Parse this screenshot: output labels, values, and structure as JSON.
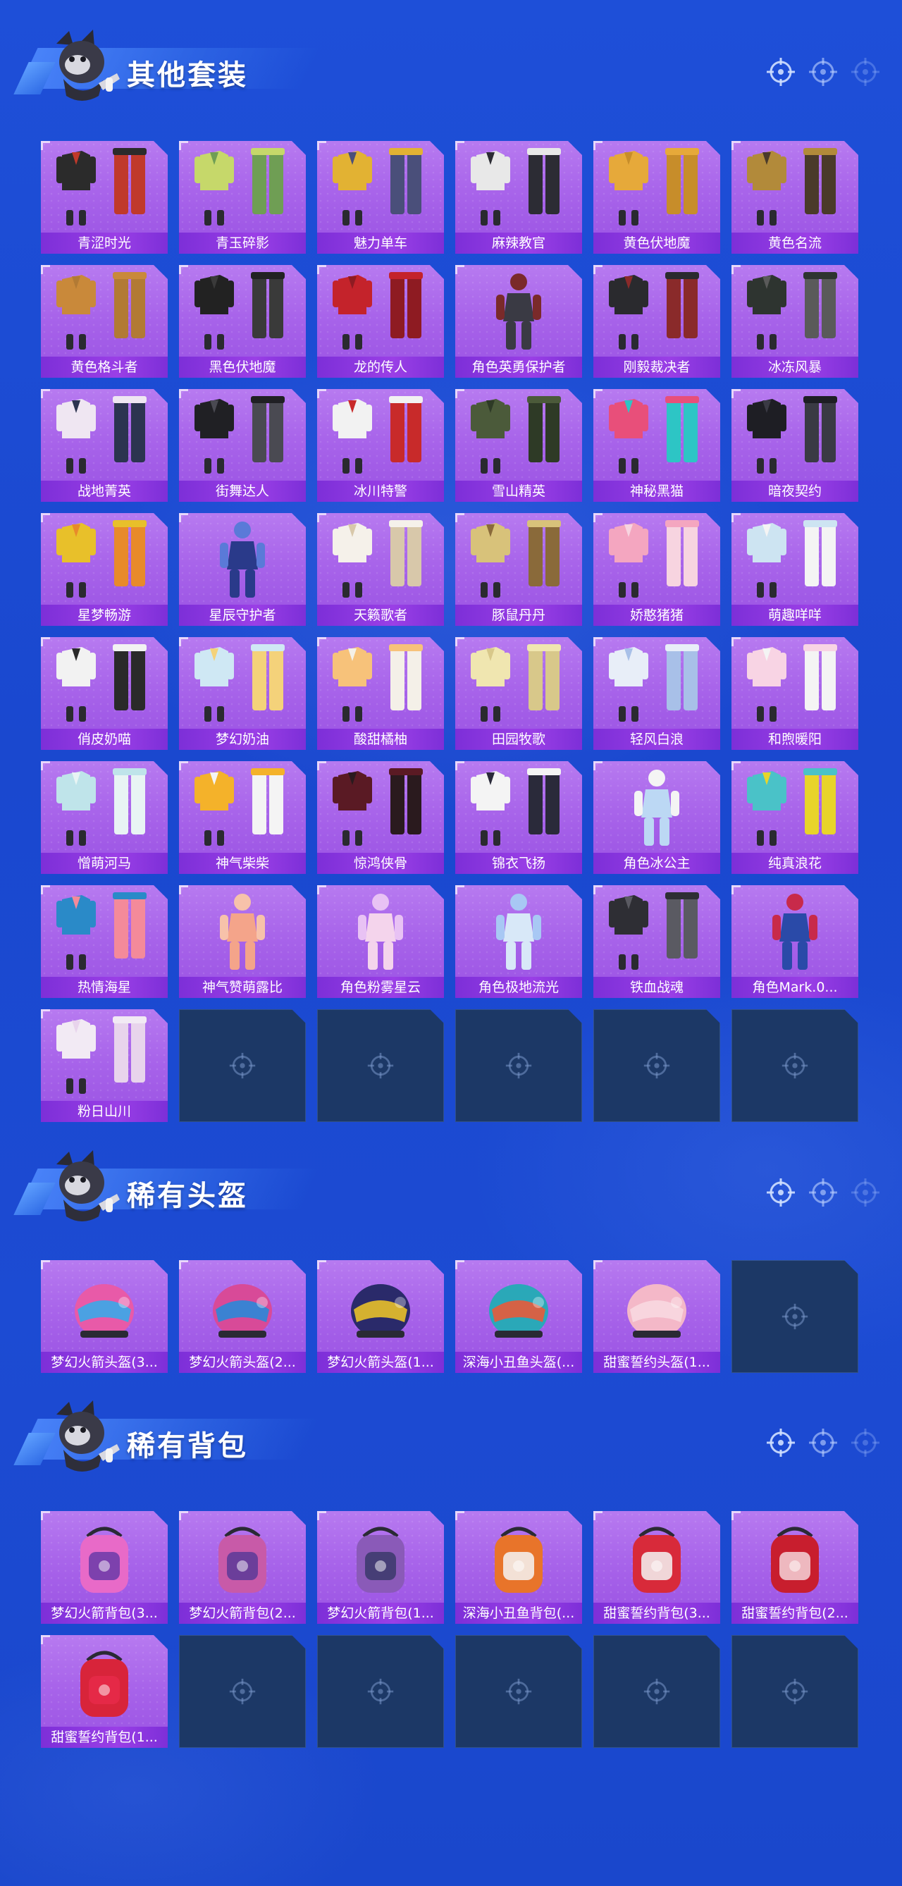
{
  "sections": [
    {
      "title": "其他套装",
      "items": [
        {
          "label": "青涩时光",
          "type": "outfit",
          "palette": [
            "#2b2b2b",
            "#c0392b"
          ]
        },
        {
          "label": "青玉碎影",
          "type": "outfit",
          "palette": [
            "#c6d86a",
            "#6f9e54"
          ]
        },
        {
          "label": "魅力单车",
          "type": "outfit",
          "palette": [
            "#e2b233",
            "#4a4f7a"
          ]
        },
        {
          "label": "麻辣教官",
          "type": "outfit",
          "palette": [
            "#e8e8e8",
            "#2c2c34"
          ]
        },
        {
          "label": "黄色伏地魔",
          "type": "outfit",
          "palette": [
            "#e6a93a",
            "#c78d2a"
          ]
        },
        {
          "label": "黄色名流",
          "type": "outfit",
          "palette": [
            "#b28a3a",
            "#4a3a2a"
          ]
        },
        {
          "label": "黄色格斗者",
          "type": "outfit",
          "palette": [
            "#c9893a",
            "#b27a34"
          ]
        },
        {
          "label": "黑色伏地魔",
          "type": "outfit",
          "palette": [
            "#222222",
            "#3a3a3a"
          ]
        },
        {
          "label": "龙的传人",
          "type": "outfit",
          "palette": [
            "#c4232b",
            "#8e1b22"
          ]
        },
        {
          "label": "角色英勇保护者",
          "type": "character",
          "palette": [
            "#3a3a44",
            "#7a2a2a"
          ]
        },
        {
          "label": "刚毅裁决者",
          "type": "outfit",
          "palette": [
            "#2a2a2e",
            "#8a2a2a"
          ]
        },
        {
          "label": "冰冻风暴",
          "type": "outfit",
          "palette": [
            "#2e3430",
            "#5a5a5a"
          ]
        },
        {
          "label": "战地菁英",
          "type": "outfit",
          "palette": [
            "#efe6f2",
            "#2c3450"
          ]
        },
        {
          "label": "街舞达人",
          "type": "outfit",
          "palette": [
            "#202024",
            "#4a4a52"
          ]
        },
        {
          "label": "冰川特警",
          "type": "outfit",
          "palette": [
            "#f2f2f2",
            "#c82a2a"
          ]
        },
        {
          "label": "雪山精英",
          "type": "outfit",
          "palette": [
            "#4b5a3a",
            "#2e3a26"
          ]
        },
        {
          "label": "神秘黑猫",
          "type": "outfit",
          "palette": [
            "#e84f7a",
            "#2dc5c5"
          ]
        },
        {
          "label": "暗夜契约",
          "type": "outfit",
          "palette": [
            "#1e1e24",
            "#3a3a44"
          ]
        },
        {
          "label": "星梦畅游",
          "type": "outfit",
          "palette": [
            "#e8c02a",
            "#e88a2a"
          ]
        },
        {
          "label": "星辰守护者",
          "type": "character",
          "palette": [
            "#2a3a8a",
            "#5a7ad8"
          ]
        },
        {
          "label": "天籁歌者",
          "type": "outfit",
          "palette": [
            "#f5f1ea",
            "#d8c8aa"
          ]
        },
        {
          "label": "豚鼠丹丹",
          "type": "outfit",
          "palette": [
            "#d8c27a",
            "#8a6a3a"
          ]
        },
        {
          "label": "娇憨猪猪",
          "type": "outfit",
          "palette": [
            "#f4a6c0",
            "#f7d4e0"
          ]
        },
        {
          "label": "萌趣咩咩",
          "type": "outfit",
          "palette": [
            "#cde4f2",
            "#f4f4f4"
          ]
        },
        {
          "label": "俏皮奶喵",
          "type": "outfit",
          "palette": [
            "#f2f2f2",
            "#2a2a2a"
          ]
        },
        {
          "label": "梦幻奶油",
          "type": "outfit",
          "palette": [
            "#cfe8f4",
            "#f4d27a"
          ]
        },
        {
          "label": "酸甜橘柚",
          "type": "outfit",
          "palette": [
            "#f7c27a",
            "#f4f0e8"
          ]
        },
        {
          "label": "田园牧歌",
          "type": "outfit",
          "palette": [
            "#f0e6b0",
            "#d8c88a"
          ]
        },
        {
          "label": "轻风白浪",
          "type": "outfit",
          "palette": [
            "#e8eef8",
            "#a8c0e8"
          ]
        },
        {
          "label": "和煦暖阳",
          "type": "outfit",
          "palette": [
            "#f8d4e4",
            "#f4f4f4"
          ]
        },
        {
          "label": "憎萌河马",
          "type": "outfit",
          "palette": [
            "#bfe4ea",
            "#e8f4f4"
          ]
        },
        {
          "label": "神气柴柴",
          "type": "outfit",
          "palette": [
            "#f4b22a",
            "#f4f4f4"
          ]
        },
        {
          "label": "惊鸿侠骨",
          "type": "outfit",
          "palette": [
            "#5a1a24",
            "#2a1a1e"
          ]
        },
        {
          "label": "锦衣飞扬",
          "type": "outfit",
          "palette": [
            "#f4f4f4",
            "#2a2a3a"
          ]
        },
        {
          "label": "角色冰公主",
          "type": "character",
          "palette": [
            "#bcd8f4",
            "#f4f4f4"
          ]
        },
        {
          "label": "纯真浪花",
          "type": "outfit",
          "palette": [
            "#4ac2c8",
            "#e8d42a"
          ]
        },
        {
          "label": "热情海星",
          "type": "outfit",
          "palette": [
            "#2a8ac8",
            "#f48a9a"
          ]
        },
        {
          "label": "神气赞萌露比",
          "type": "character",
          "palette": [
            "#f4a48a",
            "#f7c2aa"
          ]
        },
        {
          "label": "角色粉雾星云",
          "type": "character",
          "palette": [
            "#f4d4ec",
            "#e8c2f4"
          ]
        },
        {
          "label": "角色极地流光",
          "type": "character",
          "palette": [
            "#d8e8f8",
            "#a8c8f4"
          ]
        },
        {
          "label": "铁血战魂",
          "type": "outfit",
          "palette": [
            "#2e2e34",
            "#5a5a62"
          ]
        },
        {
          "label": "角色Mark.0...",
          "type": "character",
          "palette": [
            "#2a4aa8",
            "#c82a4a"
          ]
        },
        {
          "label": "粉日山川",
          "type": "outfit",
          "palette": [
            "#f2eaf4",
            "#e8d4ec"
          ]
        }
      ],
      "empty_slots": 5
    },
    {
      "title": "稀有头盔",
      "items": [
        {
          "label": "梦幻火箭头盔(3...",
          "type": "helmet",
          "palette": [
            "#e85aa8",
            "#3aa8e8"
          ]
        },
        {
          "label": "梦幻火箭头盔(2...",
          "type": "helmet",
          "palette": [
            "#d84a98",
            "#2a88d8"
          ]
        },
        {
          "label": "梦幻火箭头盔(1...",
          "type": "helmet",
          "palette": [
            "#2a2a6a",
            "#e8c02a"
          ]
        },
        {
          "label": "深海小丑鱼头盔(...",
          "type": "helmet",
          "palette": [
            "#2aa8b8",
            "#e85a3a"
          ]
        },
        {
          "label": "甜蜜誓约头盔(1...",
          "type": "helmet",
          "palette": [
            "#f4b8c8",
            "#f8d8e0"
          ]
        }
      ],
      "empty_slots": 1
    },
    {
      "title": "稀有背包",
      "items": [
        {
          "label": "梦幻火箭背包(3...",
          "type": "backpack",
          "palette": [
            "#e86ac8",
            "#6a3aa8"
          ]
        },
        {
          "label": "梦幻火箭背包(2...",
          "type": "backpack",
          "palette": [
            "#c85aa8",
            "#5a3a98"
          ]
        },
        {
          "label": "梦幻火箭背包(1...",
          "type": "backpack",
          "palette": [
            "#8a5ab8",
            "#3a3a6a"
          ]
        },
        {
          "label": "深海小丑鱼背包(...",
          "type": "backpack",
          "palette": [
            "#e8742a",
            "#f4f4f4"
          ]
        },
        {
          "label": "甜蜜誓约背包(3...",
          "type": "backpack",
          "palette": [
            "#d82a3a",
            "#f4f4f4"
          ]
        },
        {
          "label": "甜蜜誓约背包(2...",
          "type": "backpack",
          "palette": [
            "#c81e2e",
            "#f4d4d8"
          ]
        },
        {
          "label": "甜蜜誓约背包(1...",
          "type": "backpack",
          "palette": [
            "#d8243a",
            "#e82a4a"
          ]
        }
      ],
      "empty_slots": 5
    }
  ]
}
